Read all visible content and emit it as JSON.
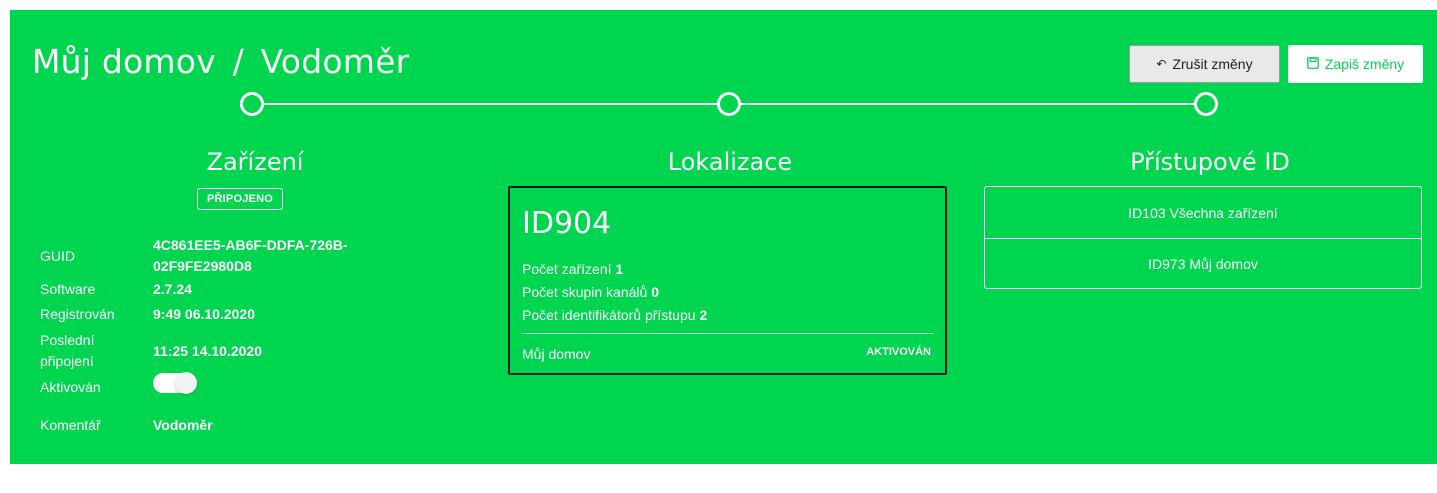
{
  "breadcrumb": {
    "home": "Můj domov",
    "separator": "/",
    "current": "Vodoměr"
  },
  "actions": {
    "cancel_label": "Zrušit změny",
    "save_label": "Zapiš změny"
  },
  "colors": {
    "panel": "#00d54f",
    "text": "#ffffff"
  },
  "device": {
    "title": "Zařízení",
    "status_badge": "PŘIPOJENO",
    "props": {
      "guid_label": "GUID",
      "guid_value": "4C861EE5-AB6F-DDFA-726B-02F9FE2980D8",
      "software_label": "Software",
      "software_value": "2.7.24",
      "registered_label": "Registrován",
      "registered_value": "9:49 06.10.2020",
      "last_connection_label": "Poslední připojení",
      "last_connection_value": "11:25 14.10.2020",
      "activated_label": "Aktivován",
      "activated_value": true,
      "comment_label": "Komentář",
      "comment_value": "Vodoměr"
    }
  },
  "location": {
    "title": "Lokalizace",
    "id": "ID904",
    "device_count_label": "Počet zařízení",
    "device_count": "1",
    "channel_group_count_label": "Počet skupin kanálů",
    "channel_group_count": "0",
    "access_id_count_label": "Počet identifikátorů přístupu",
    "access_id_count": "2",
    "name": "Můj domov",
    "status": "AKTIVOVÁN"
  },
  "access": {
    "title": "Přístupové ID",
    "items": [
      "ID103 Všechna zařízení",
      "ID973 Můj domov"
    ]
  }
}
